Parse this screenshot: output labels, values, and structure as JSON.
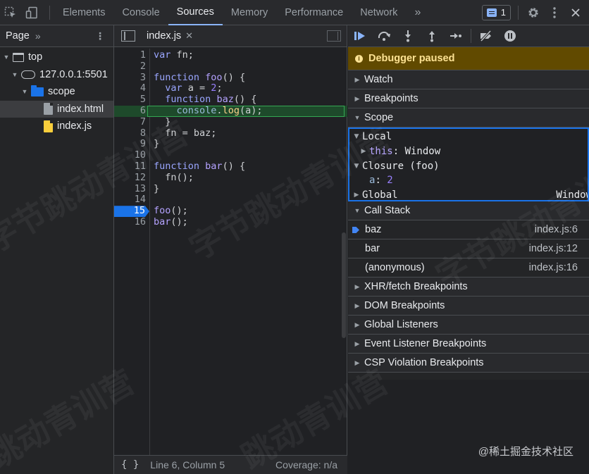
{
  "toolbar": {
    "tabs": [
      "Elements",
      "Console",
      "Sources",
      "Memory",
      "Performance",
      "Network"
    ],
    "active_tab": "Sources",
    "issues_count": "1",
    "icons": [
      "inspect-icon",
      "device-toggle-icon",
      "more-tabs-icon",
      "issues-icon",
      "gear-icon",
      "kebab-icon",
      "close-icon"
    ]
  },
  "navigator": {
    "tab": "Page",
    "tree": [
      {
        "label": "top",
        "icon": "frame-icon"
      },
      {
        "label": "127.0.0.1:5501",
        "icon": "cloud-icon"
      },
      {
        "label": "scope",
        "icon": "folder-icon"
      },
      {
        "label": "index.html",
        "icon": "html-file-icon"
      },
      {
        "label": "index.js",
        "icon": "js-file-icon"
      }
    ]
  },
  "editor": {
    "file_tab": "index.js",
    "lines": [
      {
        "n": "1",
        "code": "var fn;"
      },
      {
        "n": "2",
        "code": ""
      },
      {
        "n": "3",
        "code": "function foo() {"
      },
      {
        "n": "4",
        "code": "  var a = 2;"
      },
      {
        "n": "5",
        "code": "  function baz() {"
      },
      {
        "n": "6",
        "code": "    console.log(a);"
      },
      {
        "n": "7",
        "code": "  }"
      },
      {
        "n": "8",
        "code": "  fn = baz;"
      },
      {
        "n": "9",
        "code": "}"
      },
      {
        "n": "10",
        "code": ""
      },
      {
        "n": "11",
        "code": "function bar() {"
      },
      {
        "n": "12",
        "code": "  fn();"
      },
      {
        "n": "13",
        "code": "}"
      },
      {
        "n": "14",
        "code": ""
      },
      {
        "n": "15",
        "code": "foo();"
      },
      {
        "n": "16",
        "code": "bar();"
      }
    ],
    "status": {
      "braces": "{ }",
      "position": "Line 6, Column 5",
      "coverage": "Coverage: n/a"
    }
  },
  "debugger": {
    "paused_banner": "Debugger paused",
    "sections": {
      "watch": "Watch",
      "breakpoints": "Breakpoints",
      "scope": "Scope",
      "call_stack": "Call Stack"
    },
    "scope": {
      "local": "Local",
      "this_key": "this",
      "this_val": "Window",
      "closure": "Closure (foo)",
      "a_key": "a",
      "a_val": "2",
      "global": "Global",
      "global_val": "Window"
    },
    "call_stack": [
      {
        "name": "baz",
        "loc": "index.js:6"
      },
      {
        "name": "bar",
        "loc": "index.js:12"
      },
      {
        "name": "(anonymous)",
        "loc": "index.js:16"
      }
    ],
    "more_sections": [
      "XHR/fetch Breakpoints",
      "DOM Breakpoints",
      "Global Listeners",
      "Event Listener Breakpoints",
      "CSP Violation Breakpoints"
    ]
  },
  "watermarks": [
    "字节跳动青训营",
    "字节跳动青训营",
    "跳动青训营",
    "跳动青训营",
    "字节跳动青训营"
  ],
  "credit": "@稀土掘金技术社区",
  "colors": {
    "accent": "#8ab4f8",
    "breakpoint": "#1a73e8",
    "exec_line": "#1e4a2b",
    "paused_bg": "#614a00"
  }
}
